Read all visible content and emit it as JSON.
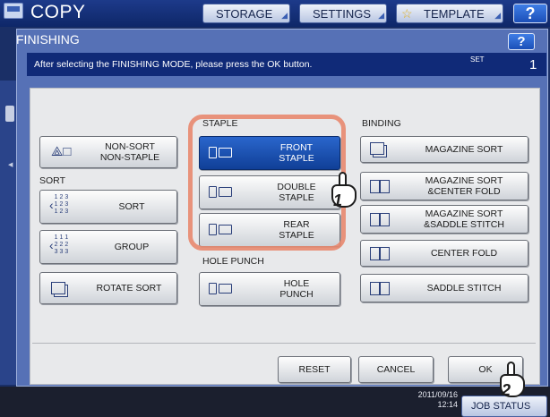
{
  "app": {
    "title": "COPY",
    "top_buttons": [
      "STORAGE",
      "SETTINGS",
      "TEMPLATE"
    ],
    "help": "?"
  },
  "dialog": {
    "title": "FINISHING",
    "help": "?",
    "message": "After selecting the FINISHING MODE, please press the OK button.",
    "set_label": "SET",
    "set_value": "1"
  },
  "sections": {
    "sort": "SORT",
    "staple": "STAPLE",
    "hole_punch": "HOLE PUNCH",
    "binding": "BINDING"
  },
  "buttons": {
    "non_sort": "NON-SORT\nNON-STAPLE",
    "sort": "SORT",
    "sort_icon_text": "1 2 3\n1 2 3\n1 2 3",
    "group": "GROUP",
    "group_icon_text": "1 1 1\n2 2 2\n3 3 3",
    "rotate_sort": "ROTATE SORT",
    "front_staple": "FRONT\nSTAPLE",
    "double_staple": "DOUBLE\nSTAPLE",
    "rear_staple": "REAR\nSTAPLE",
    "hole_punch": "HOLE\nPUNCH",
    "magazine_sort": "MAGAZINE SORT",
    "magazine_center_fold": "MAGAZINE SORT\n&CENTER FOLD",
    "magazine_saddle": "MAGAZINE SORT\n&SADDLE STITCH",
    "center_fold": "CENTER FOLD",
    "saddle_stitch": "SADDLE STITCH"
  },
  "footer": {
    "reset": "RESET",
    "cancel": "CANCEL",
    "ok": "OK"
  },
  "callouts": [
    "1",
    "2"
  ],
  "status": {
    "date": "2011/09/16",
    "time": "12:14",
    "job_status": "JOB STATUS"
  },
  "colors": {
    "selected": "#1a52b4",
    "highlight": "#e8886f",
    "dialog": "#5671b6"
  },
  "selected_staple": "FRONT STAPLE"
}
